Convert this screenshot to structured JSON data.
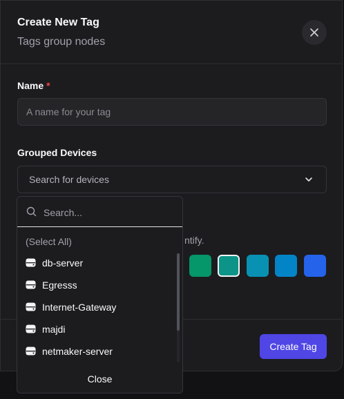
{
  "modal": {
    "title": "Create New Tag",
    "subtitle": "Tags group nodes"
  },
  "form": {
    "name_label": "Name",
    "required_marker": "*",
    "name_placeholder": "A name for your tag",
    "devices_label": "Grouped Devices",
    "devices_placeholder": "Search for devices",
    "color_hint_partial": "ntify.",
    "swatches": [
      {
        "color": "#059669",
        "selected": false
      },
      {
        "color": "#0d9488",
        "selected": true
      },
      {
        "color": "#0891b2",
        "selected": false
      },
      {
        "color": "#0284c7",
        "selected": false
      },
      {
        "color": "#2563eb",
        "selected": false
      }
    ]
  },
  "dropdown": {
    "search_placeholder": "Search...",
    "select_all": "(Select All)",
    "items": [
      {
        "label": "db-server",
        "icon": "server-icon"
      },
      {
        "label": "Egresss",
        "icon": "server-icon"
      },
      {
        "label": "Internet-Gateway",
        "icon": "server-icon"
      },
      {
        "label": "majdi",
        "icon": "server-icon"
      },
      {
        "label": "netmaker-server",
        "icon": "server-icon"
      }
    ],
    "close_label": "Close"
  },
  "footer": {
    "submit_label": "Create Tag"
  },
  "colors": {
    "accent": "#4f46e5",
    "required": "#ef4444"
  }
}
